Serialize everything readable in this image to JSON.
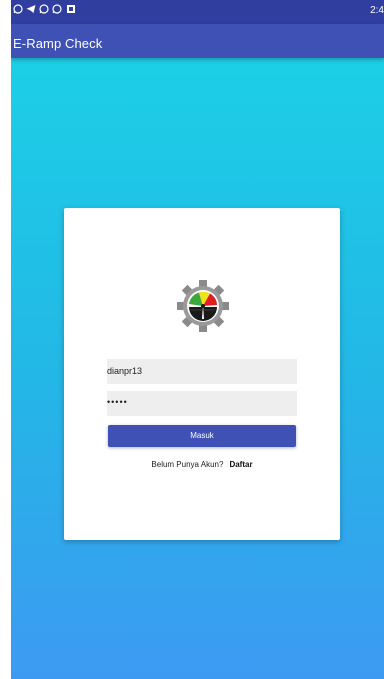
{
  "status_bar": {
    "icons": [
      "whatsapp-icon",
      "telegram-icon",
      "whatsapp-icon",
      "whatsapp-icon",
      "image-icon"
    ],
    "time": "2:4"
  },
  "app_bar": {
    "title": "E-Ramp Check"
  },
  "login": {
    "logo_icon": "gear-gauge-logo-icon",
    "username_value": "dianpr13",
    "password_value": "•••••",
    "login_button_label": "Masuk",
    "register_prompt": "Belum Punya Akun?",
    "register_link": "Daftar"
  },
  "colors": {
    "status_bar": "#303f9f",
    "app_bar": "#3f51b5",
    "button": "#3f51b5",
    "gradient_top": "#1bd3e6",
    "gradient_bottom": "#3d9af2"
  }
}
